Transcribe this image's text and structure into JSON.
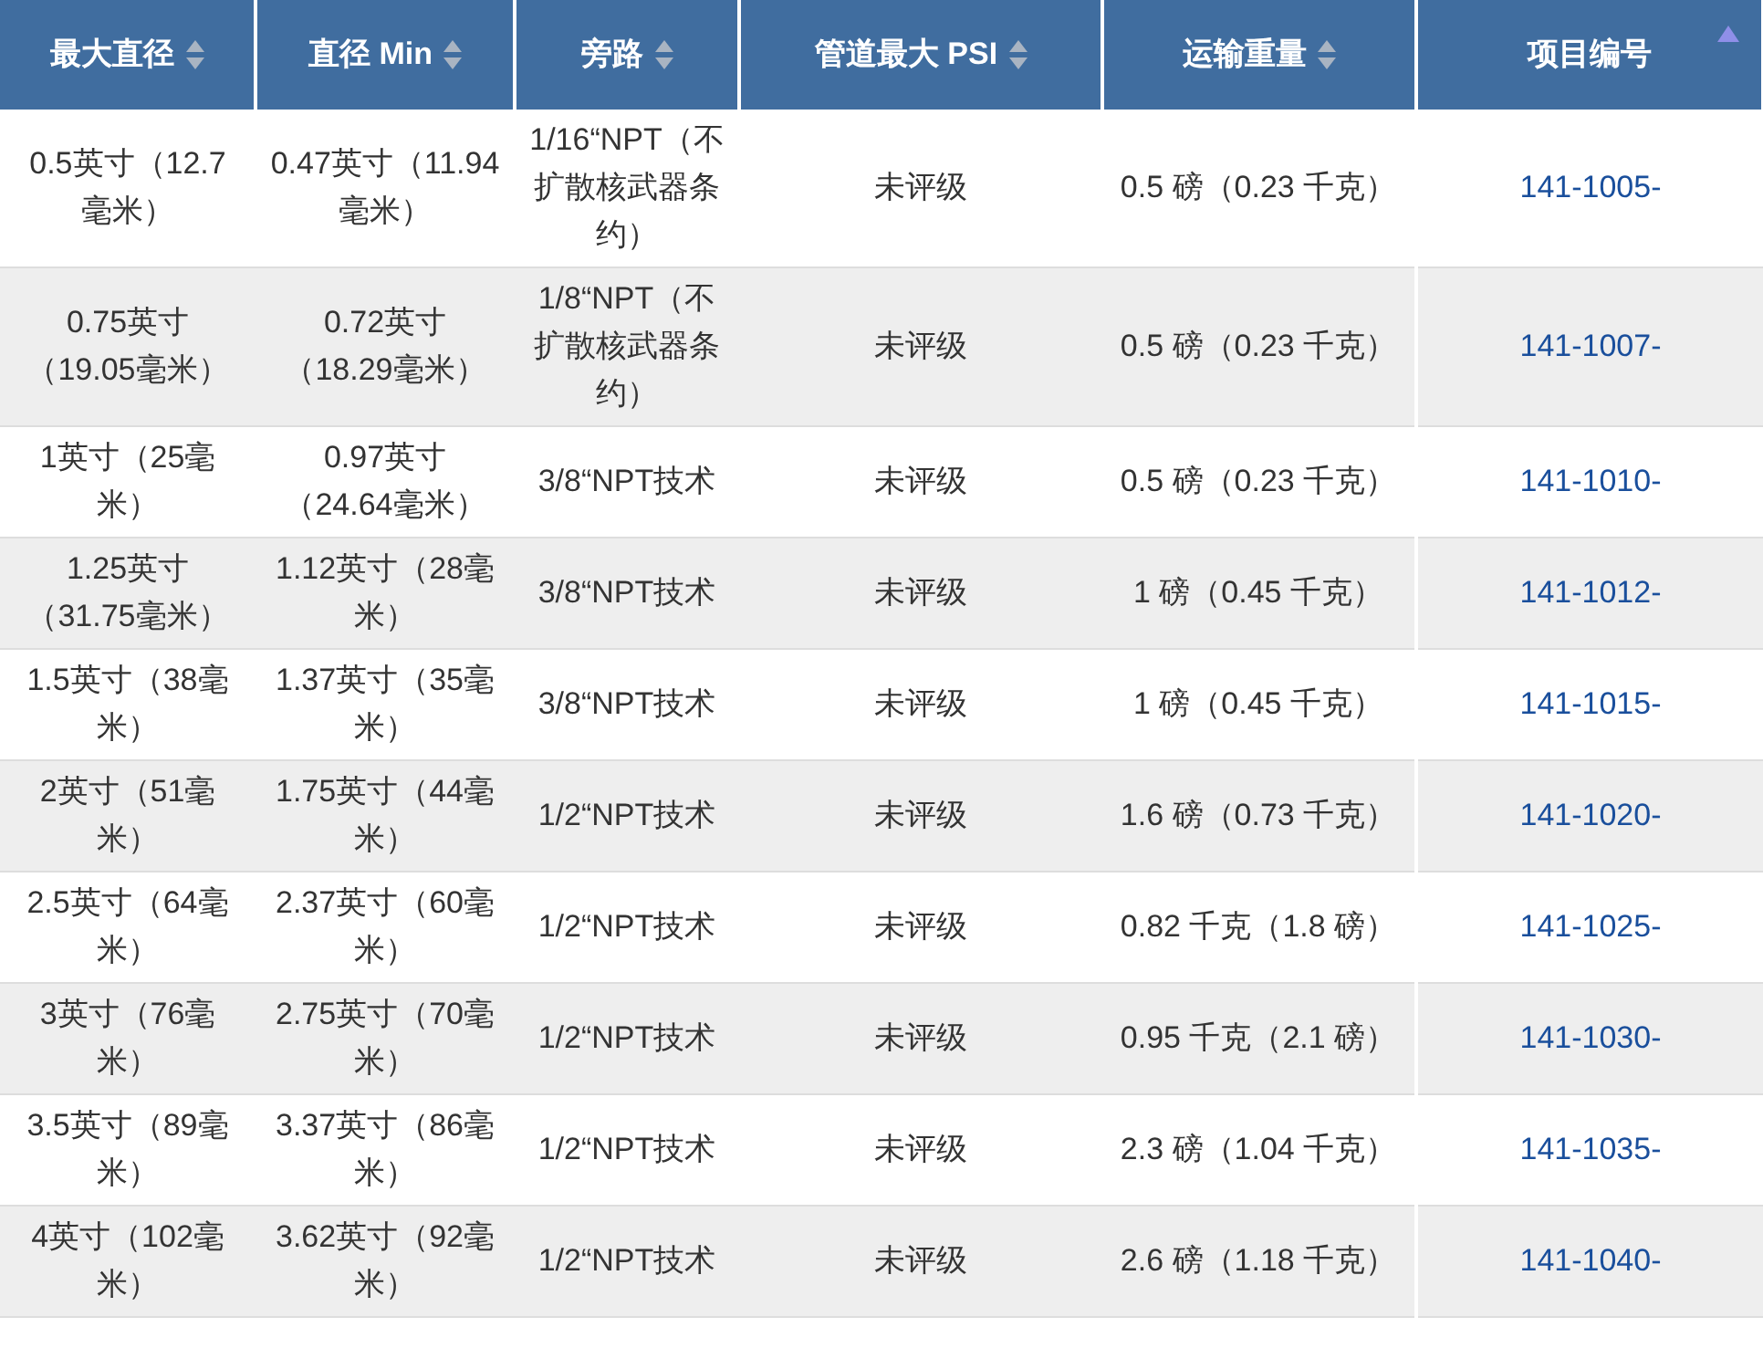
{
  "table": {
    "columns": [
      {
        "label": "最大直径",
        "sorted": false
      },
      {
        "label": "直径 Min",
        "sorted": false
      },
      {
        "label": "旁路",
        "sorted": false
      },
      {
        "label": "管道最大 PSI",
        "sorted": false
      },
      {
        "label": "运输重量",
        "sorted": false
      },
      {
        "label": "项目编号",
        "sorted": true
      }
    ],
    "rows": [
      [
        "0.5英寸（12.7毫米）",
        "0.47英寸（11.94毫米）",
        "1/16“NPT（不扩散核武器条约）",
        "未评级",
        "0.5 磅（0.23 千克）",
        "141-1005-"
      ],
      [
        "0.75英寸（19.05毫米）",
        "0.72英寸（18.29毫米）",
        "1/8“NPT（不扩散核武器条约）",
        "未评级",
        "0.5 磅（0.23 千克）",
        "141-1007-"
      ],
      [
        "1英寸（25毫米）",
        "0.97英寸（24.64毫米）",
        "3/8“NPT技术",
        "未评级",
        "0.5 磅（0.23 千克）",
        "141-1010-"
      ],
      [
        "1.25英寸（31.75毫米）",
        "1.12英寸（28毫米）",
        "3/8“NPT技术",
        "未评级",
        "1 磅（0.45 千克）",
        "141-1012-"
      ],
      [
        "1.5英寸（38毫米）",
        "1.37英寸（35毫米）",
        "3/8“NPT技术",
        "未评级",
        "1 磅（0.45 千克）",
        "141-1015-"
      ],
      [
        "2英寸（51毫米）",
        "1.75英寸（44毫米）",
        "1/2“NPT技术",
        "未评级",
        "1.6 磅（0.73 千克）",
        "141-1020-"
      ],
      [
        "2.5英寸（64毫米）",
        "2.37英寸（60毫米）",
        "1/2“NPT技术",
        "未评级",
        "0.82 千克（1.8 磅）",
        "141-1025-"
      ],
      [
        "3英寸（76毫米）",
        "2.75英寸（70毫米）",
        "1/2“NPT技术",
        "未评级",
        "0.95 千克（2.1 磅）",
        "141-1030-"
      ],
      [
        "3.5英寸（89毫米）",
        "3.37英寸（86毫米）",
        "1/2“NPT技术",
        "未评级",
        "2.3 磅（1.04 千克）",
        "141-1035-"
      ],
      [
        "4英寸（102毫米）",
        "3.62英寸（92毫米）",
        "1/2“NPT技术",
        "未评级",
        "2.6 磅（1.18 千克）",
        "141-1040-"
      ]
    ]
  }
}
